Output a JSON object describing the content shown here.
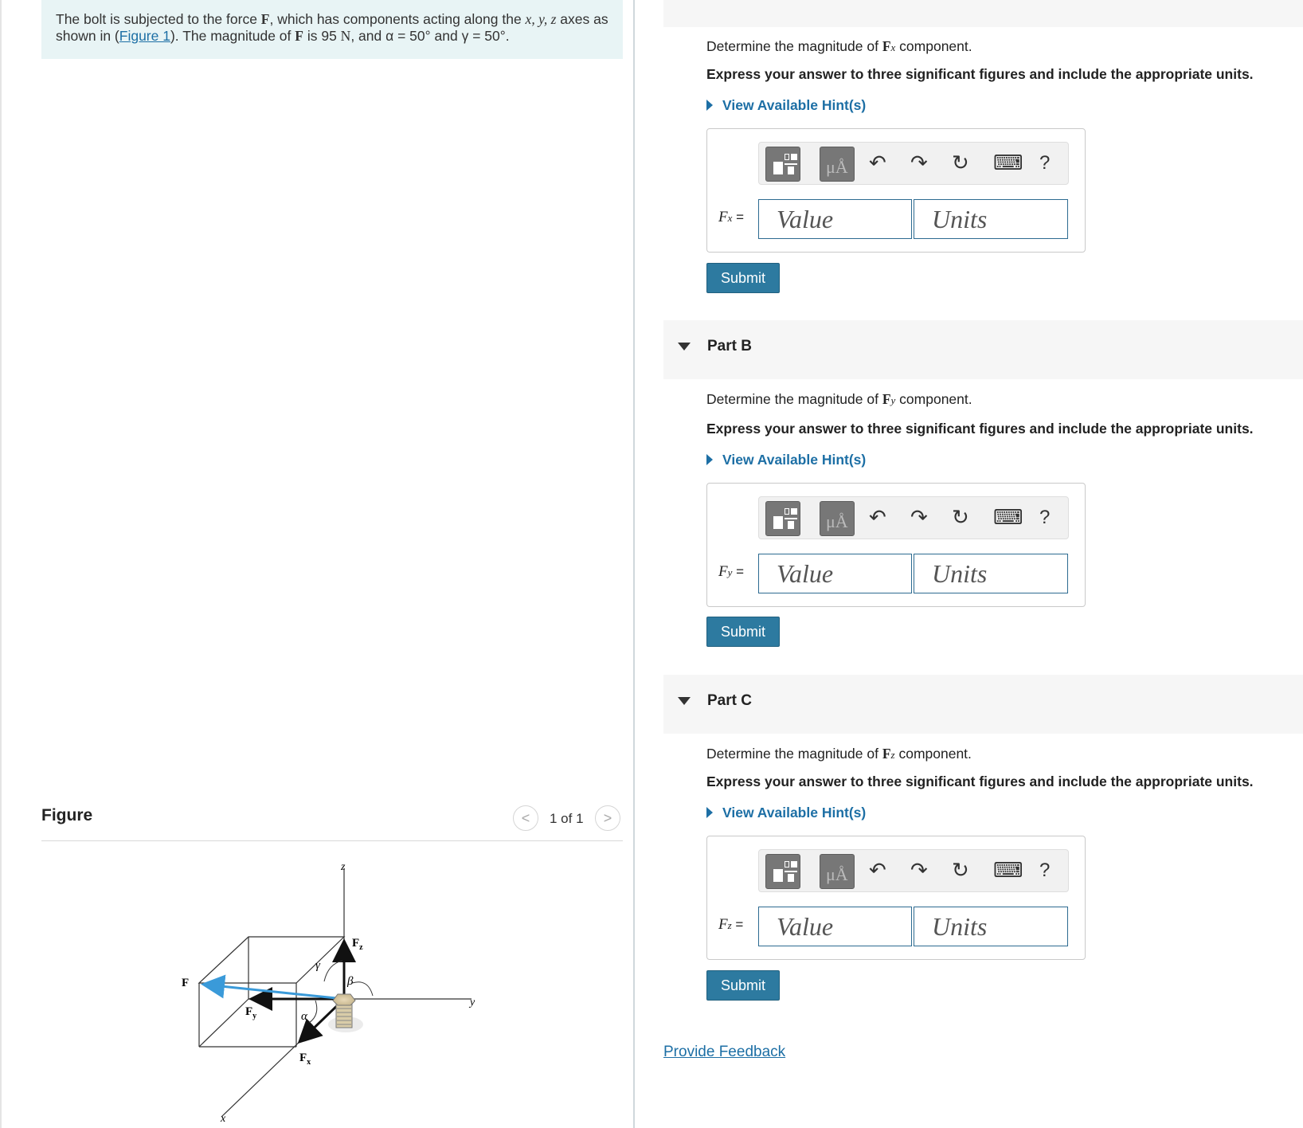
{
  "problem": {
    "text_1": "The bolt is subjected to the force ",
    "force_symbol": "F",
    "text_2": ", which has components acting along the ",
    "axes": "x, y, z",
    "text_3": " axes as shown in (",
    "figure_link": "Figure 1",
    "text_4": "). The magnitude of ",
    "text_5": " is 95 ",
    "unit": "N",
    "text_6": ", and ",
    "alpha_expr": "α = 50°",
    "text_7": " and ",
    "gamma_expr": "γ = 50°",
    "text_8": "."
  },
  "figure": {
    "title": "Figure",
    "counter": "1 of 1",
    "prev": "<",
    "next": ">",
    "labels": {
      "z": "z",
      "y": "y",
      "x": "x",
      "F": "F",
      "Fy": "F",
      "Fy_sub": "y",
      "Fx": "F",
      "Fx_sub": "x",
      "Fz": "F",
      "Fz_sub": "z",
      "alpha": "α",
      "beta": "β",
      "gamma": "γ"
    }
  },
  "parts": [
    {
      "label": "",
      "question_pre": "Determine the magnitude of ",
      "question_sym": "F",
      "question_sub": "x",
      "question_post": " component.",
      "instructions": "Express your answer to three significant figures and include the appropriate units.",
      "hint": "View Available Hint(s)",
      "var": "F",
      "var_sub": "x",
      "eq": " =",
      "value_placeholder": "Value",
      "units_placeholder": "Units",
      "submit": "Submit"
    },
    {
      "label": "Part B",
      "question_pre": "Determine the magnitude of ",
      "question_sym": "F",
      "question_sub": "y",
      "question_post": " component.",
      "instructions": "Express your answer to three significant figures and include the appropriate units.",
      "hint": "View Available Hint(s)",
      "var": "F",
      "var_sub": "y",
      "eq": " =",
      "value_placeholder": "Value",
      "units_placeholder": "Units",
      "submit": "Submit"
    },
    {
      "label": "Part C",
      "question_pre": "Determine the magnitude of ",
      "question_sym": "F",
      "question_sub": "z",
      "question_post": " component.",
      "instructions": "Express your answer to three significant figures and include the appropriate units.",
      "hint": "View Available Hint(s)",
      "var": "F",
      "var_sub": "z",
      "eq": " =",
      "value_placeholder": "Value",
      "units_placeholder": "Units",
      "submit": "Submit"
    }
  ],
  "toolbar": {
    "units_glyph": "μÅ",
    "undo_icon": "undo-icon",
    "redo_icon": "redo-icon",
    "reset_icon": "reset-icon",
    "keyboard_icon": "keyboard-icon",
    "help": "?"
  },
  "feedback": "Provide Feedback",
  "colors": {
    "accent": "#2d7aa0",
    "link": "#1d6fa5",
    "problem_bg": "#e8f4f5",
    "force_arrow": "#3a9ad9"
  }
}
